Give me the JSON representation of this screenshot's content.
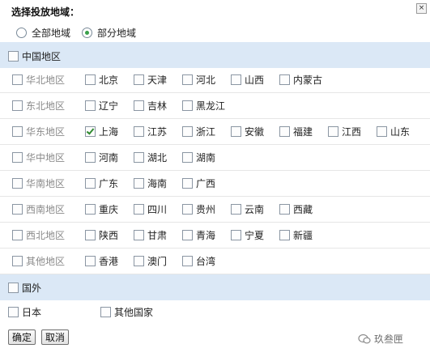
{
  "dialog": {
    "title": "选择投放地域：",
    "close_symbol": "×"
  },
  "mode": {
    "options": [
      {
        "label": "全部地域",
        "selected": false
      },
      {
        "label": "部分地域",
        "selected": true
      }
    ]
  },
  "china": {
    "header_label": "中国地区",
    "regions": [
      {
        "label": "华北地区",
        "items": [
          {
            "label": "北京",
            "checked": false
          },
          {
            "label": "天津",
            "checked": false
          },
          {
            "label": "河北",
            "checked": false
          },
          {
            "label": "山西",
            "checked": false
          },
          {
            "label": "内蒙古",
            "checked": false
          }
        ]
      },
      {
        "label": "东北地区",
        "items": [
          {
            "label": "辽宁",
            "checked": false
          },
          {
            "label": "吉林",
            "checked": false
          },
          {
            "label": "黑龙江",
            "checked": false
          }
        ]
      },
      {
        "label": "华东地区",
        "items": [
          {
            "label": "上海",
            "checked": true
          },
          {
            "label": "江苏",
            "checked": false
          },
          {
            "label": "浙江",
            "checked": false
          },
          {
            "label": "安徽",
            "checked": false
          },
          {
            "label": "福建",
            "checked": false
          },
          {
            "label": "江西",
            "checked": false
          },
          {
            "label": "山东",
            "checked": false
          }
        ]
      },
      {
        "label": "华中地区",
        "items": [
          {
            "label": "河南",
            "checked": false
          },
          {
            "label": "湖北",
            "checked": false
          },
          {
            "label": "湖南",
            "checked": false
          }
        ]
      },
      {
        "label": "华南地区",
        "items": [
          {
            "label": "广东",
            "checked": false
          },
          {
            "label": "海南",
            "checked": false
          },
          {
            "label": "广西",
            "checked": false
          }
        ]
      },
      {
        "label": "西南地区",
        "items": [
          {
            "label": "重庆",
            "checked": false
          },
          {
            "label": "四川",
            "checked": false
          },
          {
            "label": "贵州",
            "checked": false
          },
          {
            "label": "云南",
            "checked": false
          },
          {
            "label": "西藏",
            "checked": false
          }
        ]
      },
      {
        "label": "西北地区",
        "items": [
          {
            "label": "陕西",
            "checked": false
          },
          {
            "label": "甘肃",
            "checked": false
          },
          {
            "label": "青海",
            "checked": false
          },
          {
            "label": "宁夏",
            "checked": false
          },
          {
            "label": "新疆",
            "checked": false
          }
        ]
      },
      {
        "label": "其他地区",
        "items": [
          {
            "label": "香港",
            "checked": false
          },
          {
            "label": "澳门",
            "checked": false
          },
          {
            "label": "台湾",
            "checked": false
          }
        ]
      }
    ]
  },
  "abroad": {
    "header_label": "国外",
    "items": [
      {
        "label": "日本",
        "checked": false
      },
      {
        "label": "其他国家",
        "checked": false
      }
    ]
  },
  "buttons": {
    "confirm": "确定",
    "cancel": "取消"
  },
  "watermark": {
    "text": "玖叁匣"
  },
  "colors": {
    "band": "#dbe8f6",
    "check_green": "#2f8a2f"
  }
}
